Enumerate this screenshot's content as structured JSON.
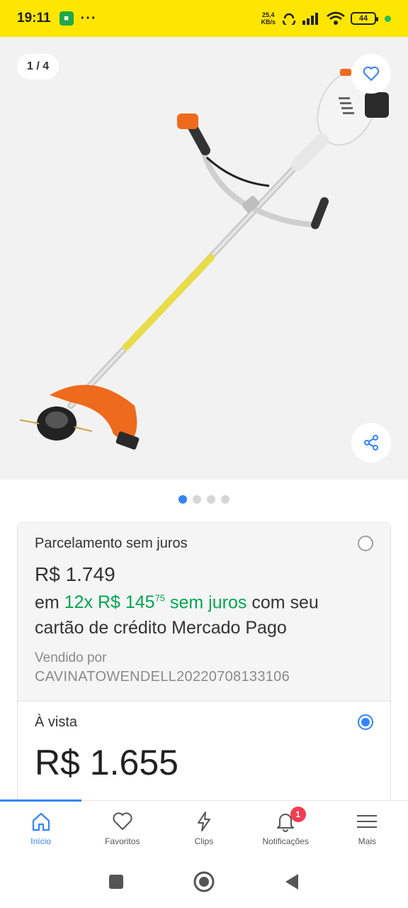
{
  "status_bar": {
    "time": "19:11",
    "more": "···",
    "net_speed_value": "25,4",
    "net_speed_unit": "KB/s",
    "battery": "44",
    "bg_color": "#ffe600"
  },
  "gallery": {
    "counter": "1 / 4",
    "favorite_icon": "heart-icon",
    "share_icon": "share-icon",
    "dots_total": 4,
    "dots_active": 1
  },
  "payment": {
    "installment_option": {
      "title": "Parcelamento sem juros",
      "price": "R$ 1.749",
      "prefix": "em",
      "installments": "12x R$ 145",
      "cents": "75",
      "no_interest": "sem juros",
      "suffix_line1": "com seu",
      "line2": "cartão de crédito Mercado Pago",
      "sold_by_label": "Vendido por",
      "seller": "CAVINATOWENDELL20220708133106",
      "selected": false
    },
    "cash_option": {
      "title": "À vista",
      "price": "R$ 1.655",
      "selected": true
    }
  },
  "bottom_nav": {
    "items": [
      {
        "label": "Início",
        "icon": "home-icon",
        "active": true
      },
      {
        "label": "Favoritos",
        "icon": "heart-icon",
        "active": false
      },
      {
        "label": "Clips",
        "icon": "lightning-icon",
        "active": false
      },
      {
        "label": "Notificações",
        "icon": "bell-icon",
        "active": false,
        "badge": "1"
      },
      {
        "label": "Mais",
        "icon": "menu-icon",
        "active": false
      }
    ]
  },
  "system_nav": {
    "recent": "square-icon",
    "home": "circle-icon",
    "back": "triangle-back-icon"
  },
  "colors": {
    "accent": "#3483fa",
    "green": "#00a650",
    "badge": "#f23d4f"
  }
}
